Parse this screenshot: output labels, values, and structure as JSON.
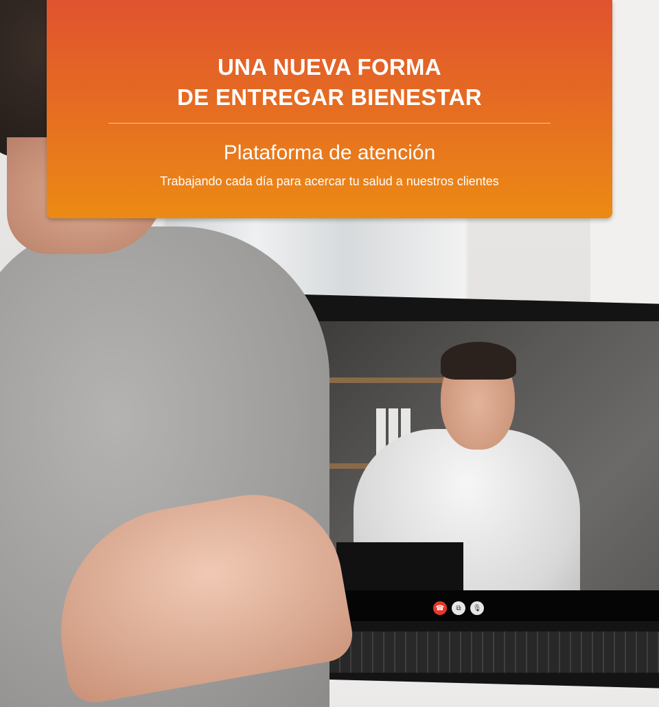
{
  "banner": {
    "title_line1": "UNA NUEVA FORMA",
    "title_line2": "DE ENTREGAR BIENESTAR",
    "subtitle": "Plataforma de atención",
    "tagline": "Trabajando cada día para acercar tu salud a nuestros clientes",
    "gradient_top": "#e0532f",
    "gradient_bottom": "#ec8a14"
  },
  "video_call": {
    "controls": [
      {
        "icon": "hang-up-icon",
        "color": "#e8372a"
      },
      {
        "icon": "switch-camera-icon",
        "color": "#e6e6e6"
      },
      {
        "icon": "microphone-icon",
        "color": "#e6e6e6"
      }
    ]
  }
}
